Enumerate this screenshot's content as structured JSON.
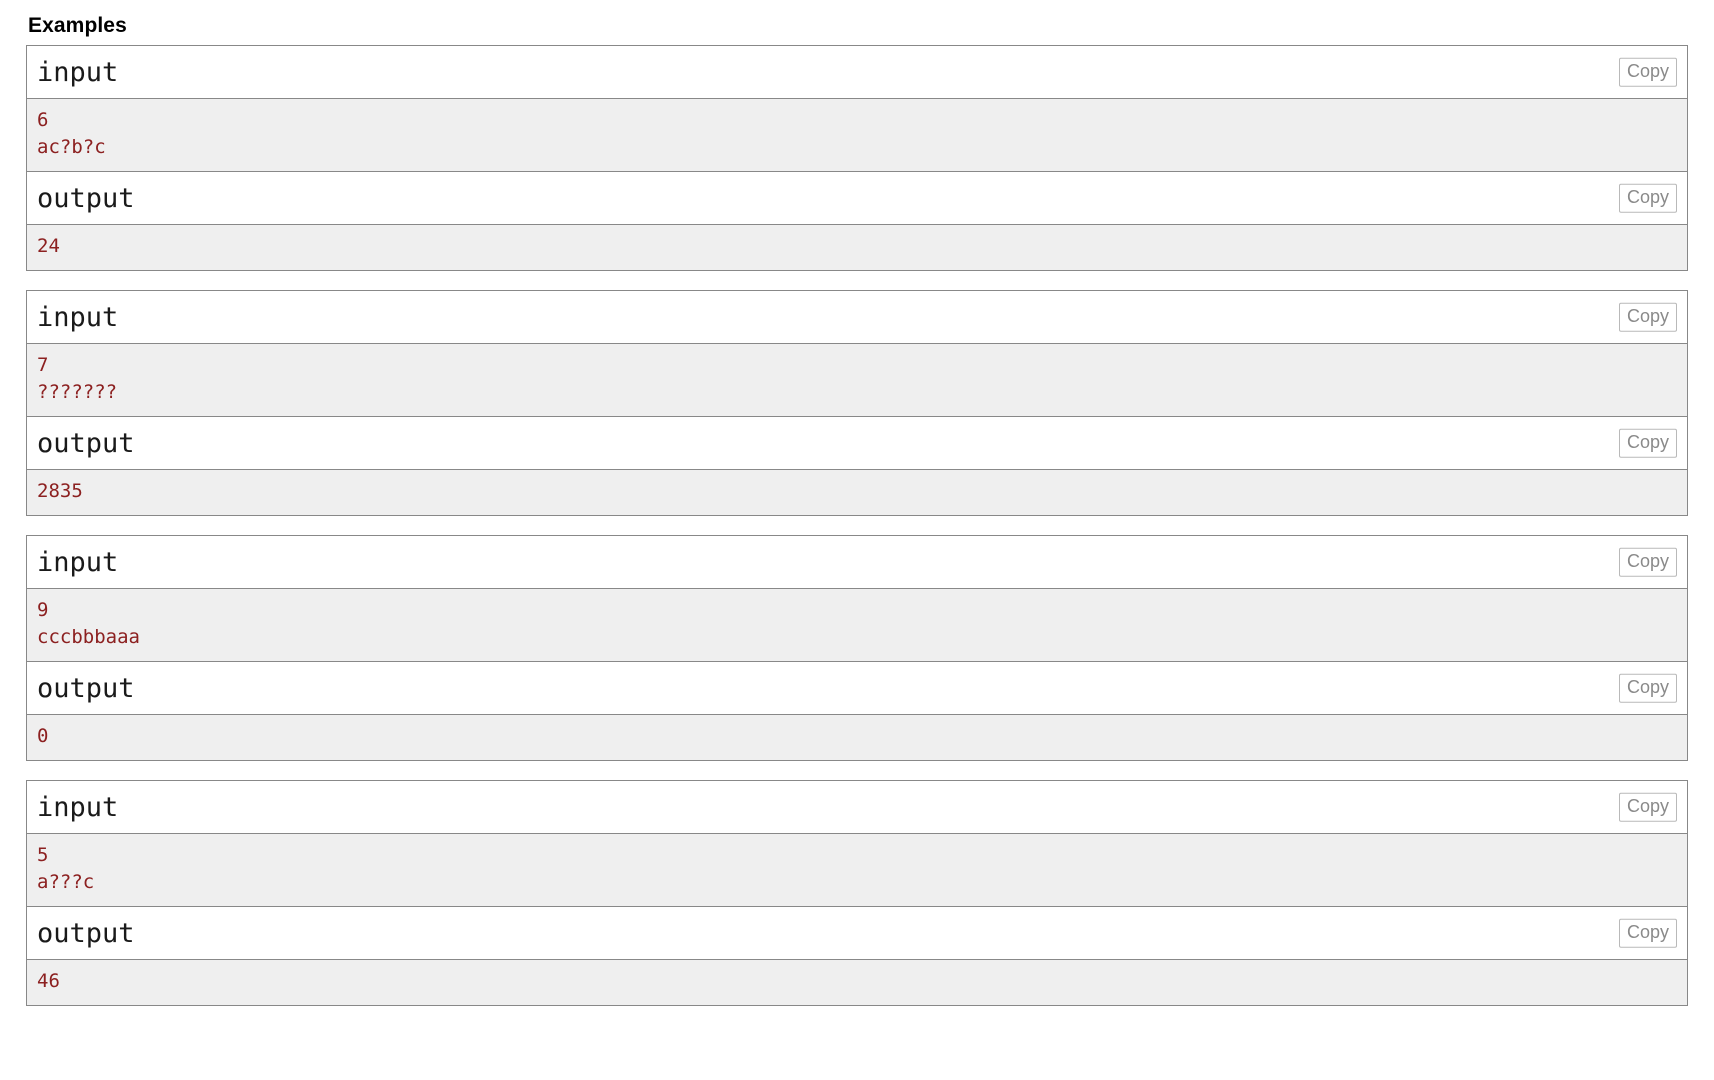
{
  "section": {
    "title": "Examples"
  },
  "labels": {
    "input": "input",
    "output": "output",
    "copy": "Copy"
  },
  "colors": {
    "text": "#000000",
    "io_text": "#8c2020",
    "io_background": "#efefef",
    "border": "#888888",
    "copy_label": "#8a8a8a",
    "copy_border": "#b9b9b9"
  },
  "examples": [
    {
      "input_label": "input",
      "input_copy": "Copy",
      "input_value": "6\nac?b?c",
      "output_label": "output",
      "output_copy": "Copy",
      "output_value": "24"
    },
    {
      "input_label": "input",
      "input_copy": "Copy",
      "input_value": "7\n???????",
      "output_label": "output",
      "output_copy": "Copy",
      "output_value": "2835"
    },
    {
      "input_label": "input",
      "input_copy": "Copy",
      "input_value": "9\ncccbbbaaa",
      "output_label": "output",
      "output_copy": "Copy",
      "output_value": "0"
    },
    {
      "input_label": "input",
      "input_copy": "Copy",
      "input_value": "5\na???c",
      "output_label": "output",
      "output_copy": "Copy",
      "output_value": "46"
    }
  ]
}
